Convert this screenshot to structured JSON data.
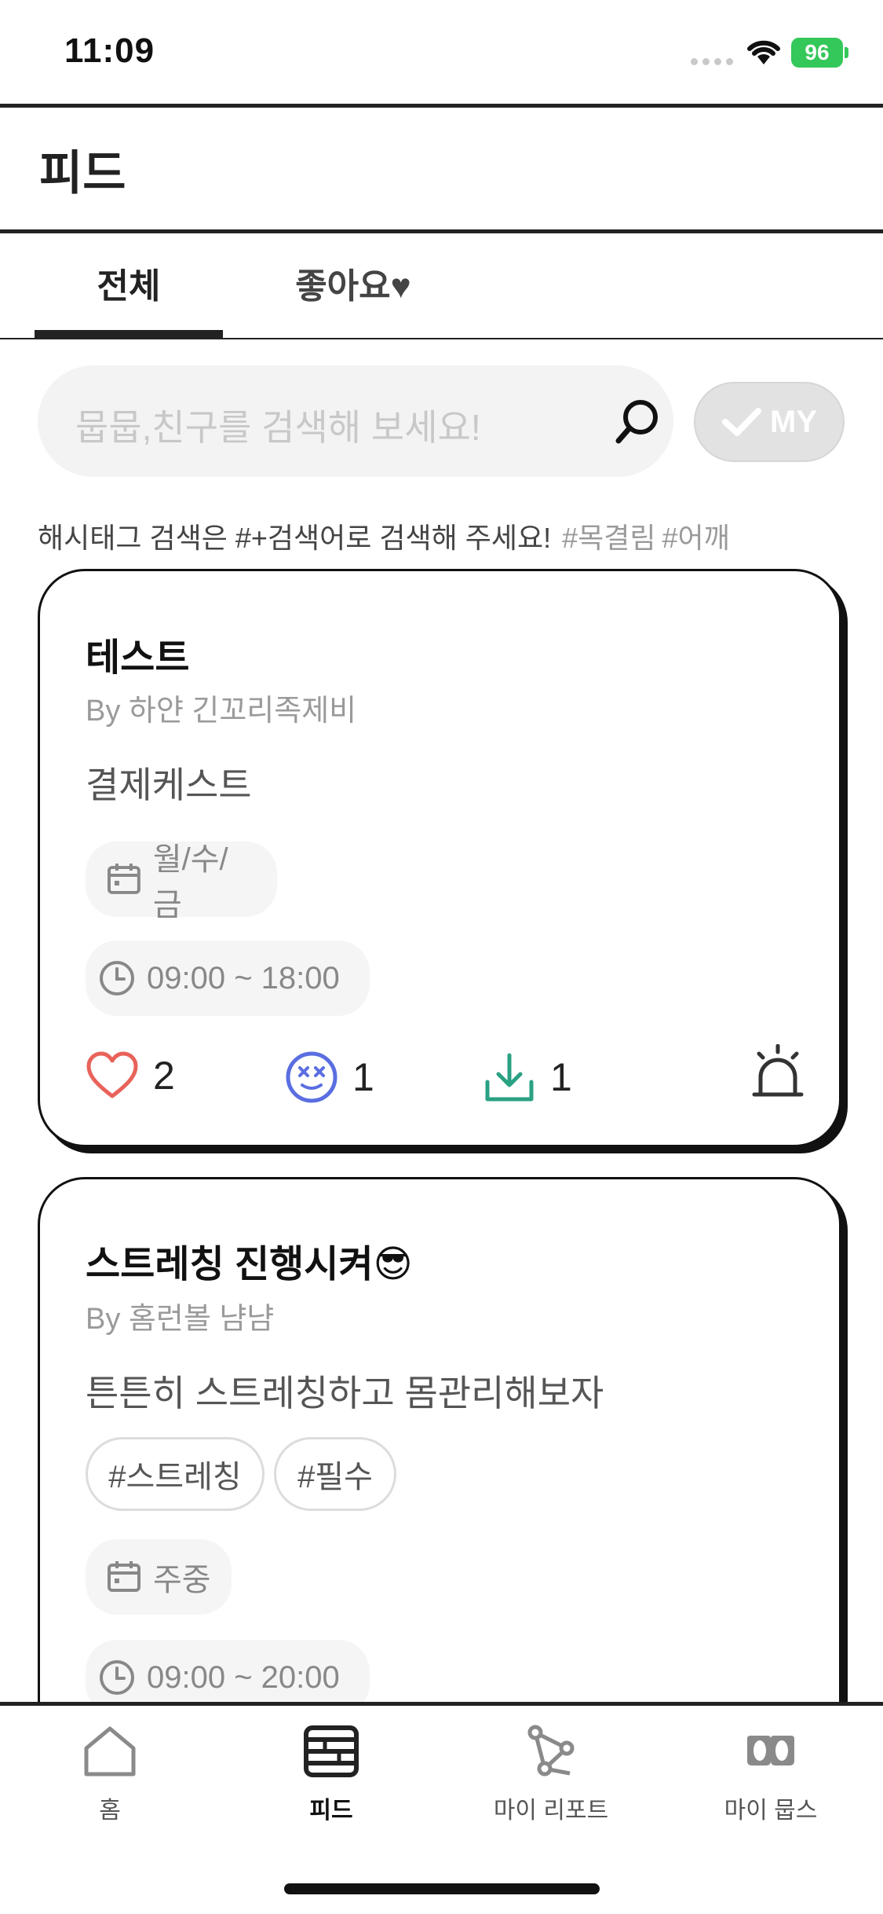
{
  "status_bar": {
    "time": "11:09",
    "battery": "96"
  },
  "header": {
    "title": "피드"
  },
  "tabs": [
    {
      "label": "전체",
      "active": true
    },
    {
      "label": "좋아요♥",
      "active": false
    }
  ],
  "search": {
    "placeholder": "뭅뭅,친구를 검색해 보세요!",
    "my_toggle_label": "MY"
  },
  "hint": {
    "text": "해시태그 검색은 #+검색어로 검색해 주세요!",
    "example_tags": [
      "#목결림",
      "#어깨"
    ]
  },
  "feed": [
    {
      "title": "테스트",
      "author": "By 하얀 긴꼬리족제비",
      "description": "결제케스트",
      "hashtags": [],
      "days": "월/수/금",
      "time": "09:00 ~ 18:00",
      "likes": "2",
      "reactions": "1",
      "downloads": "1"
    },
    {
      "title": "스트레칭 진행시켜😎",
      "author": "By 홈런볼 냠냠",
      "description": "튼튼히 스트레칭하고 몸관리해보자",
      "hashtags": [
        "#스트레칭",
        "#필수"
      ],
      "days": "주중",
      "time": "09:00 ~ 20:00"
    }
  ],
  "bottom_nav": [
    {
      "label": "홈",
      "icon": "home-icon",
      "active": false
    },
    {
      "label": "피드",
      "icon": "feed-icon",
      "active": true
    },
    {
      "label": "마이 리포트",
      "icon": "report-icon",
      "active": false
    },
    {
      "label": "마이 뭅스",
      "icon": "moves-icon",
      "active": false
    }
  ],
  "colors": {
    "accent_battery": "#34c759",
    "like": "#e8635a",
    "reaction": "#5b6ee1",
    "download": "#2aa183"
  }
}
